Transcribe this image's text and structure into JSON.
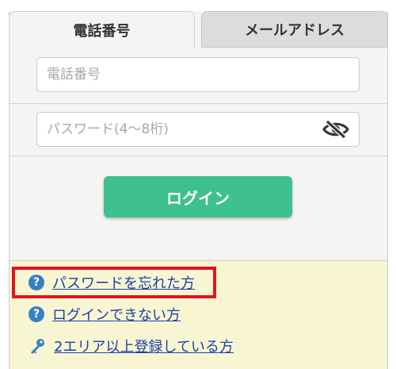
{
  "tabs": [
    {
      "label": "電話番号",
      "active": true
    },
    {
      "label": "メールアドレス",
      "active": false
    }
  ],
  "form": {
    "phone_placeholder": "電話番号",
    "phone_value": "",
    "password_placeholder": "パスワード(4〜8桁)",
    "password_value": "",
    "password_toggle_icon": "eye-slash-icon",
    "login_label": "ログイン"
  },
  "help": {
    "links": [
      {
        "label": "パスワードを忘れた方",
        "icon": "question-circle-icon",
        "highlighted": true
      },
      {
        "label": "ログインできない方",
        "icon": "question-circle-icon",
        "highlighted": false
      },
      {
        "label": "2エリア以上登録している方",
        "icon": "key-icon",
        "highlighted": false
      }
    ],
    "question_mark": "?"
  },
  "colors": {
    "accent_green": "#3ec08f",
    "link_blue": "#1f3fa8",
    "help_background": "#f8f6d2",
    "highlight_red": "#e0141e",
    "icon_blue": "#3a7fc2"
  }
}
